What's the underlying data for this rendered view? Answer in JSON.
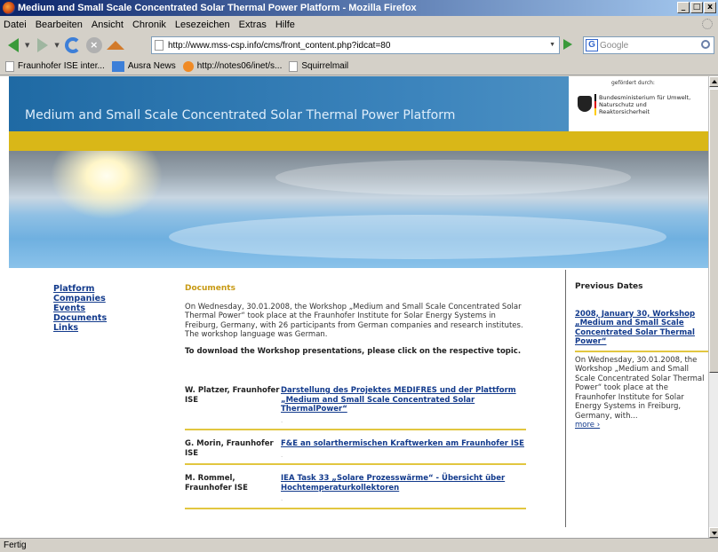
{
  "window": {
    "title": "Medium and Small Scale Concentrated Solar Thermal Power Platform - Mozilla Firefox",
    "min": "_",
    "max": "□",
    "close": "x"
  },
  "menu": [
    "Datei",
    "Bearbeiten",
    "Ansicht",
    "Chronik",
    "Lesezeichen",
    "Extras",
    "Hilfe"
  ],
  "nav": {
    "url": "http://www.mss-csp.info/cms/front_content.php?idcat=80",
    "search_placeholder": "Google",
    "g_logo": "G"
  },
  "bookmarks": [
    "Fraunhofer ISE inter...",
    "Ausra News",
    "http://notes06/inet/s...",
    "Squirrelmail"
  ],
  "site": {
    "title": "Medium and Small Scale Concentrated Solar Thermal Power Platform",
    "sponsor_label": "gefördert durch:",
    "sponsor_name": "Bundesministerium für Umwelt, Naturschutz und Reaktorsicherheit"
  },
  "leftnav": [
    "Platform",
    "Companies",
    "Events",
    "Documents",
    "Links"
  ],
  "main": {
    "heading": "Documents",
    "intro": "On Wednesday, 30.01.2008, the Workshop „Medium and Small Scale Concentrated Solar Thermal Power“ took place at the Fraunhofer Institute for Solar Energy Systems in Freiburg, Germany, with 26 participants from German companies and research institutes. The workshop language was German.",
    "download": "To download the Workshop presentations, please click on the respective topic.",
    "presentations": [
      {
        "speaker": "W. Platzer, Fraunhofer ISE",
        "title": "Darstellung des Projektes MEDIFRES und der Plattform „Medium and Small Scale Concentrated Solar ThermalPower“"
      },
      {
        "speaker": "G. Morin, Fraunhofer ISE",
        "title": "F&E an solarthermischen Kraftwerken am Fraunhofer ISE"
      },
      {
        "speaker": "M. Rommel, Fraunhofer ISE",
        "title": "IEA Task 33 „Solare Prozesswärme“ - Übersicht über Hochtemperaturkollektoren"
      }
    ],
    "dot": "."
  },
  "right": {
    "heading": "Previous Dates",
    "link": "2008, January 30, Workshop „Medium and Small Scale Concentrated Solar Thermal Power“",
    "text": "On Wednesday, 30.01.2008, the Workshop „Medium and Small Scale Concentrated Solar Thermal Power“ took place at the Fraunhofer Institute for Solar Energy Systems in Freiburg, Germany, with...",
    "more": "more ›"
  },
  "status": "Fertig"
}
